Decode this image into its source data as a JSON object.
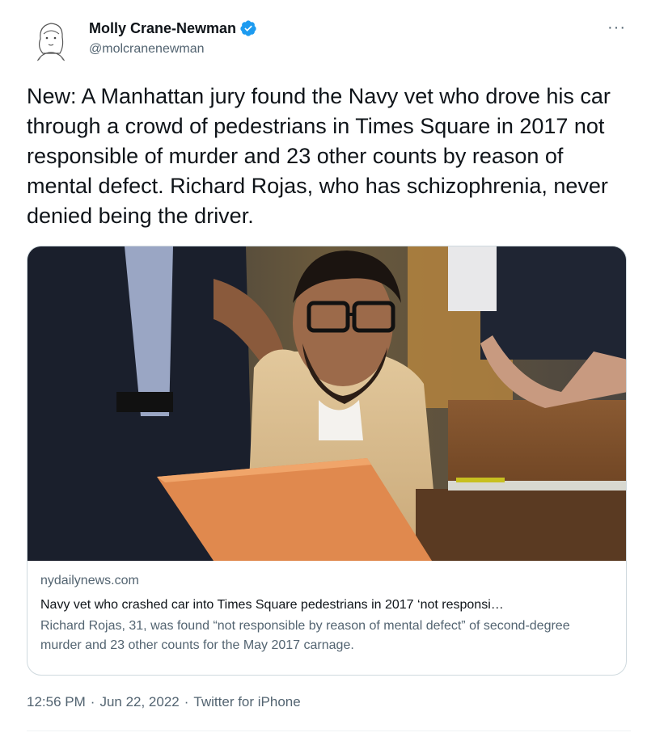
{
  "author": {
    "name": "Molly Crane-Newman",
    "handle": "@molcranenewman",
    "verified": true
  },
  "more_icon": "···",
  "tweet": {
    "text": "New: A Manhattan jury found the Navy vet who drove his car through a crowd of pedestrians in Times Square in 2017 not responsible of murder and 23 other counts by reason of mental defect. Richard Rojas, who has schizophrenia, never denied being the driver."
  },
  "card": {
    "domain": "nydailynews.com",
    "title": "Navy vet who crashed car into Times Square pedestrians in 2017 ‘not responsi…",
    "description": "Richard Rojas, 31, was found “not responsible by reason of mental defect” of second-degree murder and 23 other counts for the May 2017 carnage."
  },
  "footer": {
    "time": "12:56 PM",
    "separator": "·",
    "date": "Jun 22, 2022",
    "source": "Twitter for iPhone"
  },
  "colors": {
    "verified_blue": "#1d9bf0",
    "text_primary": "#0f1419",
    "text_secondary": "#536471",
    "border": "#cfd9de"
  }
}
